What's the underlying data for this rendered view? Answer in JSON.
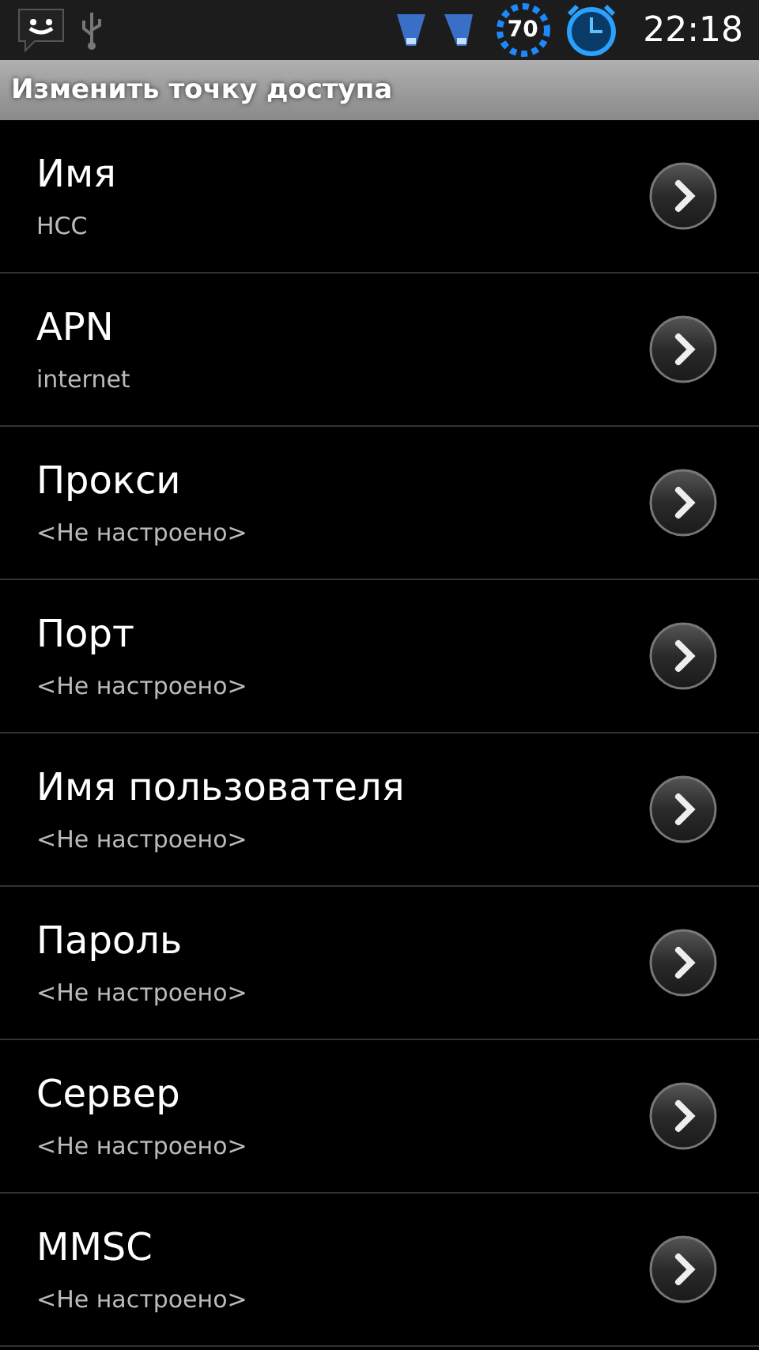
{
  "status_bar": {
    "battery": "70",
    "time": "22:18"
  },
  "title": "Изменить точку доступа",
  "items": [
    {
      "label": "Имя",
      "value": "HCC"
    },
    {
      "label": "APN",
      "value": "internet"
    },
    {
      "label": "Прокси",
      "value": "<Не настроено>"
    },
    {
      "label": "Порт",
      "value": "<Не настроено>"
    },
    {
      "label": "Имя пользователя",
      "value": "<Не настроено>"
    },
    {
      "label": "Пароль",
      "value": "<Не настроено>"
    },
    {
      "label": "Сервер",
      "value": "<Не настроено>"
    },
    {
      "label": "MMSC",
      "value": "<Не настроено>"
    }
  ]
}
